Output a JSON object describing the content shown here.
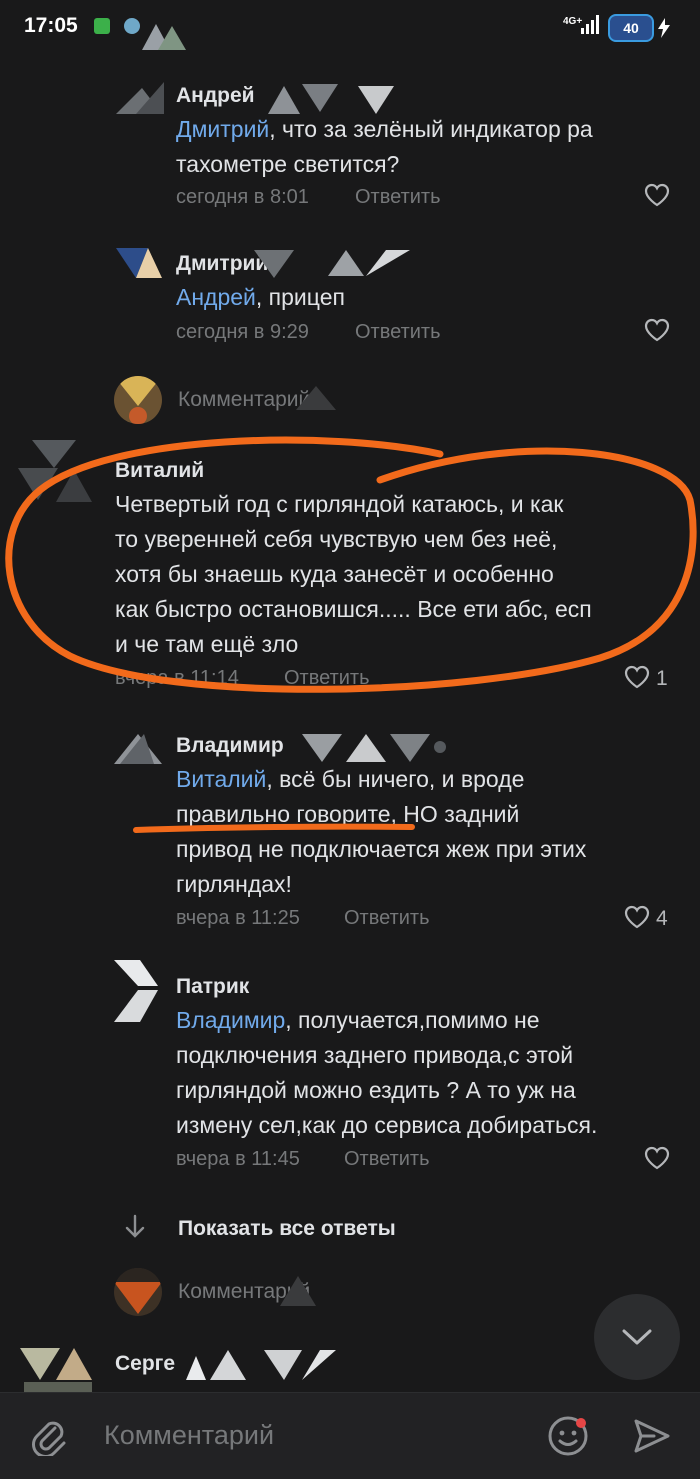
{
  "status_bar": {
    "time": "17:05",
    "network": "4G+",
    "battery": "40"
  },
  "comments": [
    {
      "author": "Андрей",
      "mention": "Дмитрий",
      "text": ", что за зелёный индикатор ра тахометре светится?",
      "time": "сегодня в 8:01",
      "reply": "Ответить"
    },
    {
      "author": "Дмитрий",
      "mention": "Андрей",
      "text": ", прицеп",
      "time": "сегодня в 9:29",
      "reply": "Ответить"
    },
    {
      "author": "Виталий",
      "text_lines": [
        "Четвертый год с гирляндой катаюсь, и как",
        "то уверенней себя чувствую чем без неё,",
        "хотя бы знаешь куда занесёт и особенно",
        "как быстро остановишся..... Все ети абс, есп",
        "и че там ещё зло"
      ],
      "time": "вчера в 11:14",
      "reply": "Ответить",
      "likes": "1"
    },
    {
      "author": "Владимир",
      "mention": "Виталий",
      "line1_rest": ", всё бы ничего, и вроде",
      "lines": [
        "правильно говорите, НО задний",
        "привод не подключается жеж при этих",
        "гирляндах!"
      ],
      "time": "вчера в 11:25",
      "reply": "Ответить",
      "likes": "4"
    },
    {
      "author": "Патрик",
      "mention": "Владимир",
      "line1_rest": ", получается,помимо не",
      "lines": [
        "подключения заднего привода,с этой",
        "гирляндой можно ездить ? А то уж на",
        "измену сел,как до сервиса добираться."
      ],
      "time": "вчера в 11:45",
      "reply": "Ответить"
    }
  ],
  "reply_composer_placeholder": "Комментарий",
  "show_all_replies": "Показать все ответы",
  "next_author": "Серге",
  "bottom_bar": {
    "placeholder": "Комментарий"
  },
  "colors": {
    "background": "#19191a",
    "mention": "#71aaeb",
    "annotation": "#f26a1b"
  }
}
